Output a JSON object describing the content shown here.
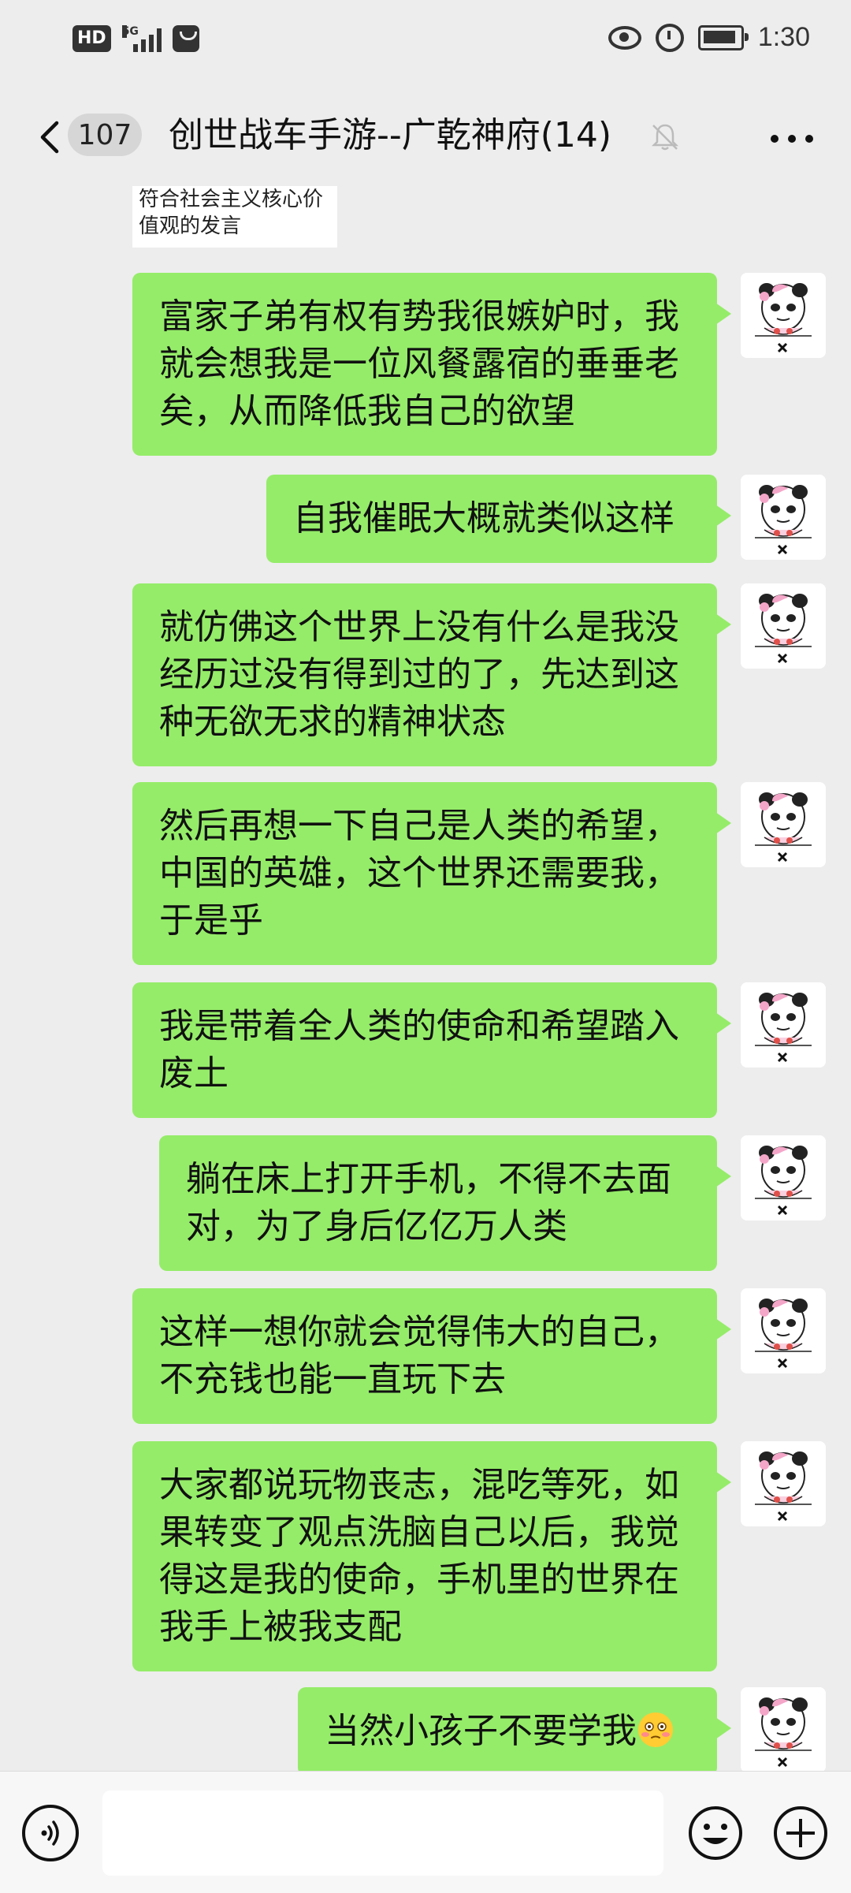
{
  "status_bar": {
    "hd": "HD",
    "network": "5G",
    "time": "1:30"
  },
  "header": {
    "unread_count": "107",
    "title": "创世战车手游--广乾神府(14)"
  },
  "quote": {
    "text": "符合社会主义核心价值观的发言"
  },
  "messages": [
    {
      "text": "富家子弟有权有势我很嫉妒时，我就会想我是一位风餐露宿的垂垂老矣，从而降低我自己的欲望"
    },
    {
      "text": "自我催眠大概就类似这样"
    },
    {
      "text": "就仿佛这个世界上没有什么是我没经历过没有得到过的了，先达到这种无欲无求的精神状态"
    },
    {
      "text": "然后再想一下自己是人类的希望，中国的英雄，这个世界还需要我，于是乎"
    },
    {
      "text": "我是带着全人类的使命和希望踏入废土"
    },
    {
      "text": "躺在床上打开手机，不得不去面对，为了身后亿亿万人类"
    },
    {
      "text": "这样一想你就会觉得伟大的自己，不充钱也能一直玩下去"
    },
    {
      "text": "大家都说玩物丧志，混吃等死，如果转变了观点洗脑自己以后，我觉得这是我的使命，手机里的世界在我手上被我支配"
    },
    {
      "text": "当然小孩子不要学我",
      "emoji": "flushed-face-icon"
    }
  ],
  "icons": {
    "back": "chevron-left-icon",
    "mute": "bell-muted-icon",
    "more": "more-dots-icon",
    "voice": "voice-icon",
    "emoji": "smiley-icon",
    "add": "plus-icon"
  },
  "colors": {
    "background": "#ededed",
    "bubble": "#95ec69",
    "input_bar": "#f7f7f7"
  }
}
